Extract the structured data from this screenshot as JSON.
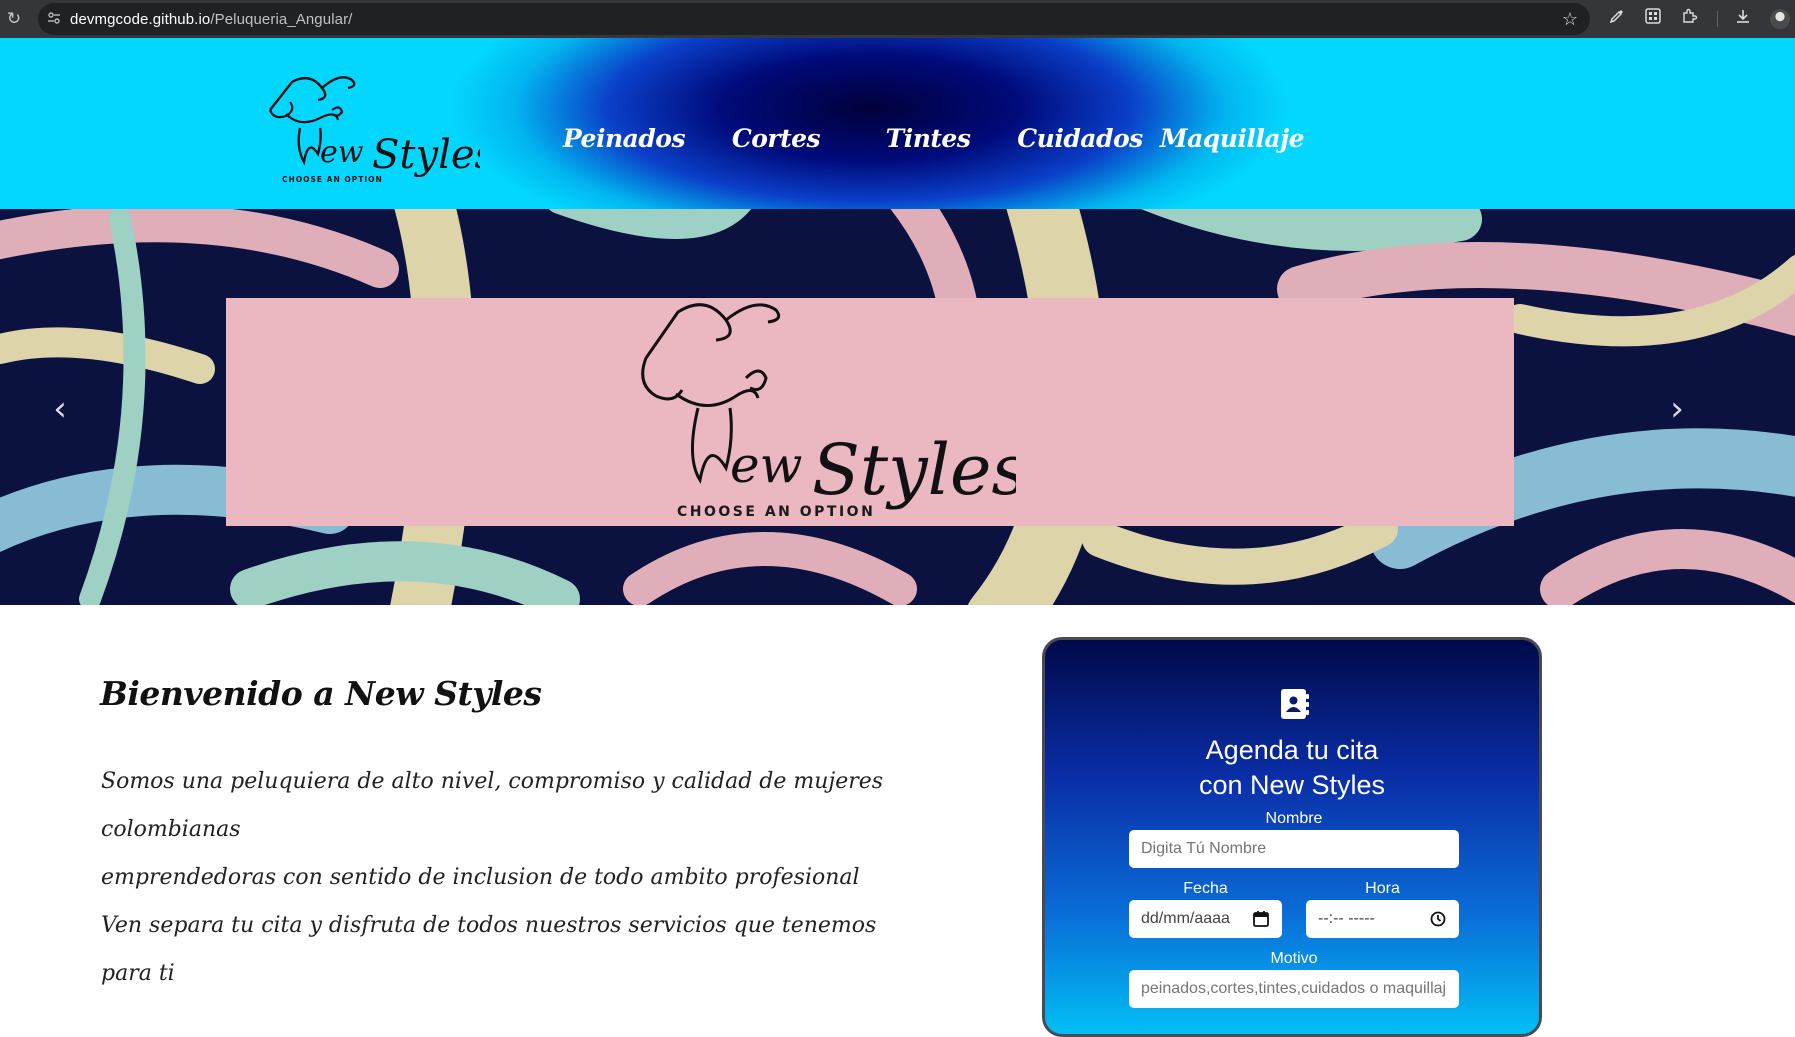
{
  "browser": {
    "url_domain": "devmgcode.github.io",
    "url_path": "/Peluqueria_Angular/"
  },
  "header": {
    "logo_caption": "CHOOSE AN OPTION",
    "nav": [
      {
        "label": "Peinados"
      },
      {
        "label": "Cortes"
      },
      {
        "label": "Tintes"
      },
      {
        "label": "Cuidados"
      },
      {
        "label": "Maquillaje"
      }
    ]
  },
  "carousel": {
    "caption": "CHOOSE AN OPTION",
    "colors": {
      "navy": "#0c1240",
      "pink": "#ebb7c0",
      "cream": "#e9dfb0",
      "blue": "#8fc6dc",
      "mint": "#a6dccc"
    }
  },
  "welcome": {
    "title": "Bienvenido a New Styles",
    "line1": "Somos una peluquiera de alto nivel, compromiso y calidad de mujeres colombianas",
    "line2": "emprendedoras con sentido de inclusion de todo ambito profesional",
    "line3": "Ven separa tu cita y disfruta de todos nuestros servicios que tenemos para ti"
  },
  "booking": {
    "title_line1": "Agenda tu cita",
    "title_line2": "con New Styles",
    "name_label": "Nombre",
    "name_placeholder": "Digita Tú Nombre",
    "date_label": "Fecha",
    "date_value": "dd/mm/aaaa",
    "time_label": "Hora",
    "time_value": "--:-- -----",
    "reason_label": "Motivo",
    "reason_placeholder": "peinados,cortes,tintes,cuidados o maquillaje"
  }
}
